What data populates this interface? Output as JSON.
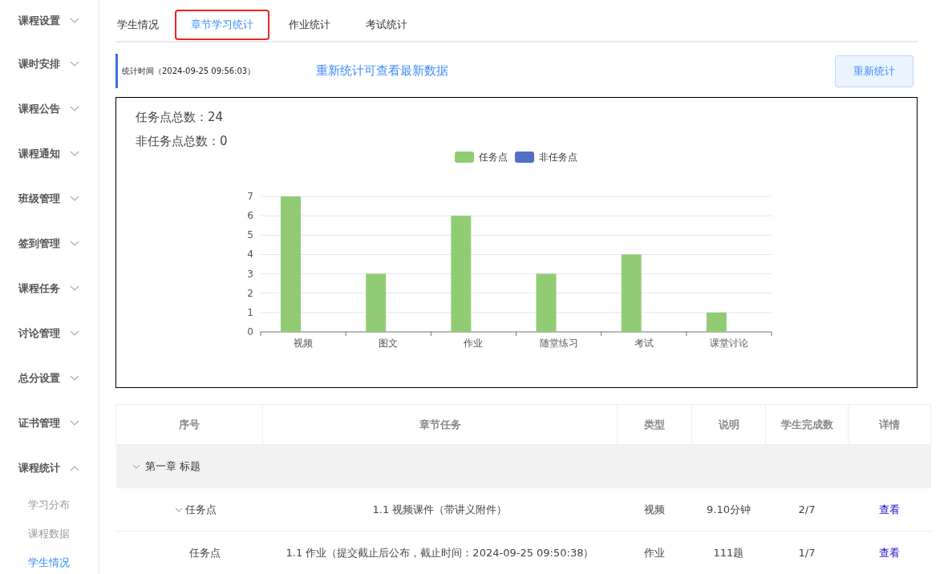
{
  "sidebar": {
    "items": [
      {
        "label": "课程设置",
        "expanded": false
      },
      {
        "label": "课时安排",
        "expanded": false
      },
      {
        "label": "课程公告",
        "expanded": false
      },
      {
        "label": "课程通知",
        "expanded": false
      },
      {
        "label": "班级管理",
        "expanded": false
      },
      {
        "label": "签到管理",
        "expanded": false
      },
      {
        "label": "课程任务",
        "expanded": false
      },
      {
        "label": "讨论管理",
        "expanded": false
      },
      {
        "label": "总分设置",
        "expanded": false
      },
      {
        "label": "证书管理",
        "expanded": false
      },
      {
        "label": "课程统计",
        "expanded": true,
        "children": [
          {
            "label": "学习分布",
            "selected": false
          },
          {
            "label": "课程数据",
            "selected": false
          },
          {
            "label": "学生情况",
            "selected": true
          }
        ]
      }
    ]
  },
  "tabs": [
    {
      "label": "学生情况",
      "selected": false
    },
    {
      "label": "章节学习统计",
      "selected": true
    },
    {
      "label": "作业统计",
      "selected": false
    },
    {
      "label": "考试统计",
      "selected": false
    }
  ],
  "stats_bar": {
    "time": "统计时间（2024-09-25 09:56:03）",
    "hint": "重新统计可查看最新数据",
    "button": "重新统计"
  },
  "summary": {
    "task_points": "任务点总数：24",
    "non_task_points": "非任务点总数：0"
  },
  "chart_data": {
    "type": "bar",
    "categories": [
      "视频",
      "图文",
      "作业",
      "随堂练习",
      "考试",
      "课堂讨论"
    ],
    "series": [
      {
        "name": "任务点",
        "color": "#91cc75",
        "values": [
          7,
          3,
          6,
          3,
          4,
          1
        ]
      },
      {
        "name": "非任务点",
        "color": "#5470c6",
        "values": [
          0,
          0,
          0,
          0,
          0,
          0
        ]
      }
    ],
    "ylim": [
      0,
      7
    ],
    "grid": true,
    "yticks": [
      0,
      1,
      2,
      3,
      4,
      5,
      6,
      7
    ]
  },
  "table": {
    "columns": [
      "序号",
      "章节任务",
      "类型",
      "说明",
      "学生完成数",
      "详情"
    ],
    "chapters": [
      {
        "title": "第一章 标题",
        "expanded": true,
        "children": [
          {
            "label": "任务点",
            "expandable": true,
            "task": "1.1 视频课件（带讲义附件）",
            "type": "视频",
            "note": "9.10分钟",
            "done": "2/7",
            "link": "查看"
          },
          {
            "label": "任务点",
            "expandable": false,
            "task": "1.1 作业（提交截止后公布，截止时间：2024-09-25 09:50:38）",
            "type": "作业",
            "note": "111题",
            "done": "1/7",
            "link": "查看"
          }
        ]
      }
    ]
  }
}
